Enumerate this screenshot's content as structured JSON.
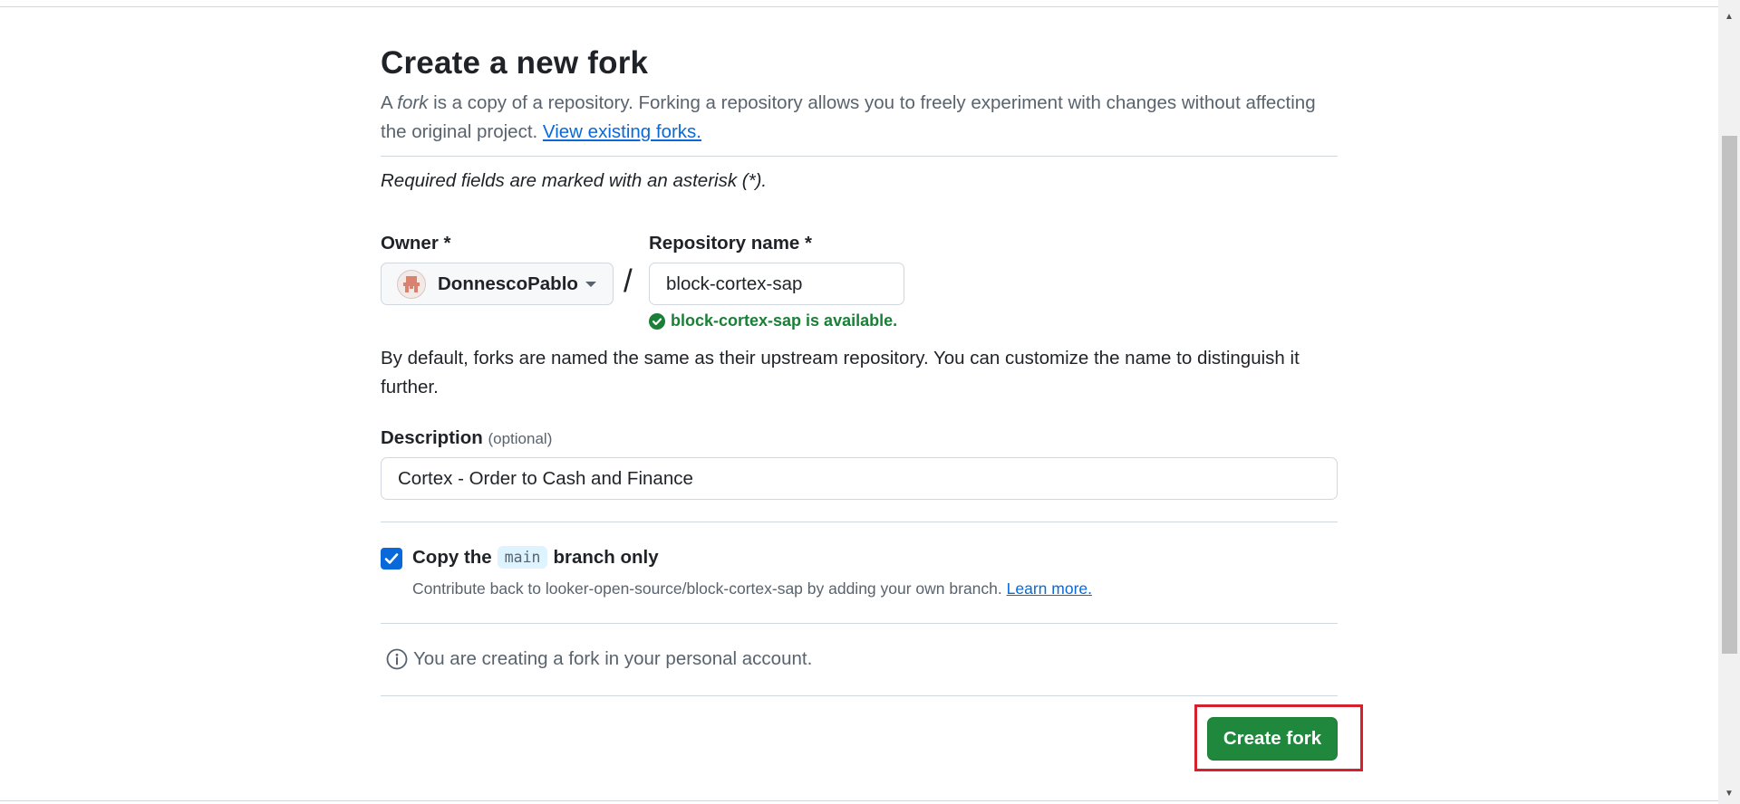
{
  "page": {
    "title": "Create a new fork",
    "intro_prefix": "A ",
    "intro_fork_word": "fork",
    "intro_rest": " is a copy of a repository. Forking a repository allows you to freely experiment with changes without affecting the original project. ",
    "view_forks_link": "View existing forks.",
    "required_note": "Required fields are marked with an asterisk (*)."
  },
  "owner": {
    "label": "Owner *",
    "value": "DonnescoPablo"
  },
  "repository": {
    "label": "Repository name *",
    "value": "block-cortex-sap",
    "availability": "block-cortex-sap is available."
  },
  "default_note": "By default, forks are named the same as their upstream repository. You can customize the name to distinguish it further.",
  "description": {
    "label": "Description",
    "optional_label": "(optional)",
    "value": "Cortex - Order to Cash and Finance"
  },
  "copy_branch": {
    "checked": true,
    "label_prefix": "Copy the",
    "branch": "main",
    "label_suffix": "branch only",
    "help_text": "Contribute back to looker-open-source/block-cortex-sap by adding your own branch.",
    "learn_more": "Learn more."
  },
  "info": {
    "text": "You are creating a fork in your personal account."
  },
  "actions": {
    "create_fork": "Create fork"
  },
  "colors": {
    "primary_button": "#1f883d",
    "link": "#0969da",
    "success": "#1a7f37",
    "highlight": "#d5202e"
  }
}
